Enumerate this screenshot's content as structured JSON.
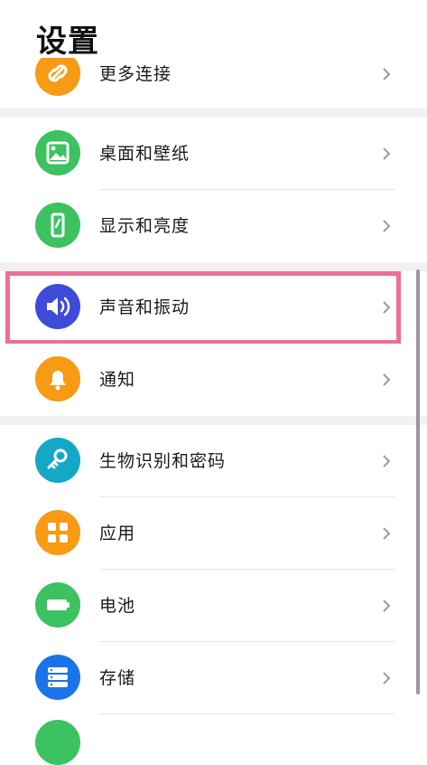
{
  "page": {
    "title": "设置"
  },
  "colors": {
    "more_connections": "#f79a14",
    "desktop": "#3cc25f",
    "display": "#3cc25f",
    "sound": "#3d4bd8",
    "notifications": "#f79a14",
    "biometrics": "#12a8c6",
    "apps": "#f79a14",
    "battery": "#3cc25f",
    "storage": "#1a73e8",
    "highlight": "#ee6f96"
  },
  "sections": [
    {
      "items": [
        {
          "id": "more-connections",
          "label": "更多连接",
          "icon": "link-icon"
        }
      ]
    },
    {
      "items": [
        {
          "id": "desktop-wallpaper",
          "label": "桌面和壁纸",
          "icon": "image-icon"
        },
        {
          "id": "display-brightness",
          "label": "显示和亮度",
          "icon": "phone-brightness-icon"
        },
        {
          "id": "sound-vibration",
          "label": "声音和振动",
          "icon": "speaker-icon",
          "highlighted": true
        },
        {
          "id": "notifications",
          "label": "通知",
          "icon": "bell-icon"
        }
      ]
    },
    {
      "items": [
        {
          "id": "biometrics-password",
          "label": "生物识别和密码",
          "icon": "key-icon"
        },
        {
          "id": "apps",
          "label": "应用",
          "icon": "grid-icon"
        },
        {
          "id": "battery",
          "label": "电池",
          "icon": "battery-icon"
        },
        {
          "id": "storage",
          "label": "存储",
          "icon": "storage-icon"
        }
      ]
    }
  ]
}
